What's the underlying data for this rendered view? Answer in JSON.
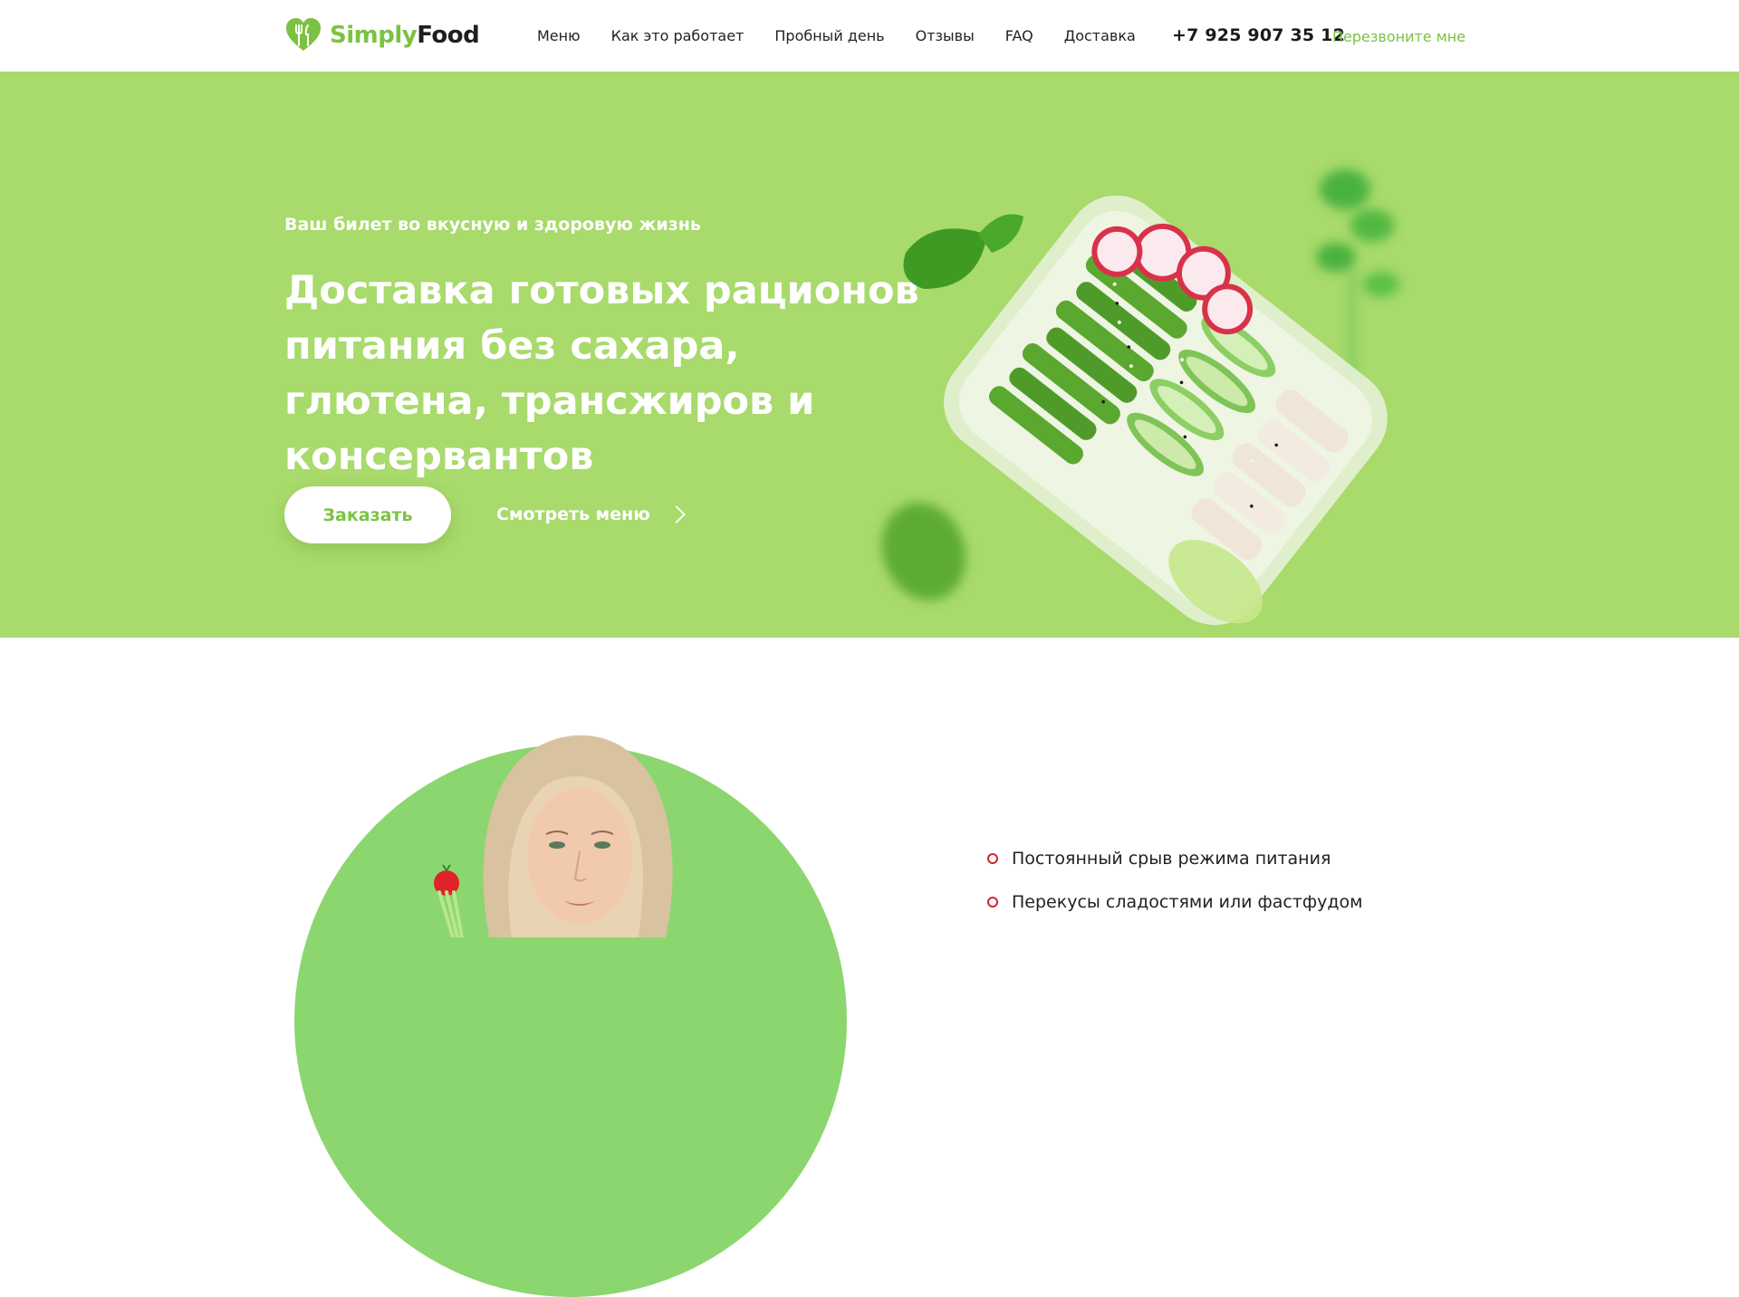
{
  "brand": {
    "name_part1": "Simply",
    "name_part2": "Food",
    "accent": "#7cc242",
    "hero_bg": "#a8da6c"
  },
  "nav": [
    {
      "label": "Меню"
    },
    {
      "label": "Как это работает"
    },
    {
      "label": "Пробный день"
    },
    {
      "label": "Отзывы"
    },
    {
      "label": "FAQ"
    },
    {
      "label": "Доставка"
    }
  ],
  "contact": {
    "phone": "+7 925 907 35 12",
    "callback_label": "Перезвоните мне"
  },
  "hero": {
    "tagline": "Ваш билет во вкусную и здоровую жизнь",
    "headline": "Доставка готовых рационов питания без сахара, глютена, трансжиров и консервантов",
    "order_button": "Заказать",
    "menu_link": "Смотреть меню",
    "menu_link_icon": "chevron-right-icon"
  },
  "pains": [
    {
      "text": "Постоянный срыв режима питания"
    },
    {
      "text": "Перекусы сладостями или фастфудом"
    }
  ]
}
